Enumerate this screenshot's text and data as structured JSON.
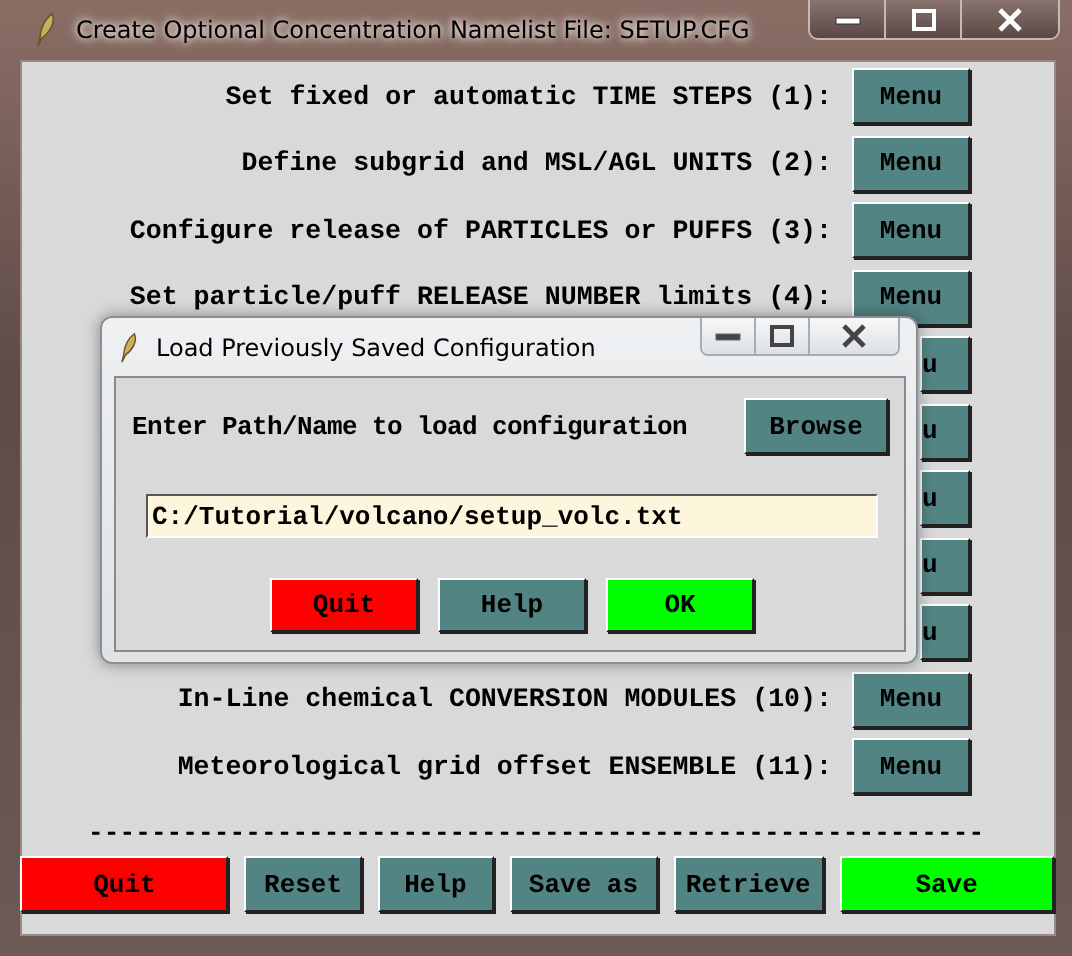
{
  "window": {
    "title": "Create Optional Concentration Namelist File: SETUP.CFG"
  },
  "rows": [
    {
      "kind": "labeled",
      "label": "Set fixed or automatic TIME STEPS (1):",
      "button": "Menu"
    },
    {
      "kind": "labeled",
      "label": "Define subgrid and MSL/AGL UNITS (2):",
      "button": "Menu"
    },
    {
      "kind": "labeled",
      "label": "Configure release of PARTICLES or PUFFS (3):",
      "button": "Menu"
    },
    {
      "kind": "labeled",
      "label": "Set particle/puff RELEASE NUMBER limits (4):",
      "button": "Menu"
    },
    {
      "kind": "covered",
      "button": "u"
    },
    {
      "kind": "covered",
      "button": "u"
    },
    {
      "kind": "covered",
      "button": "u"
    },
    {
      "kind": "covered",
      "button": "u"
    },
    {
      "kind": "covered",
      "button": "u"
    },
    {
      "kind": "labeled",
      "label": "In-Line chemical CONVERSION MODULES (10):",
      "button": "Menu"
    },
    {
      "kind": "labeled",
      "label": "Meteorological grid offset ENSEMBLE (11):",
      "button": "Menu"
    }
  ],
  "separator": "---------------------------------------------------------",
  "buttons": [
    {
      "label": "Quit",
      "color": "#ff0000"
    },
    {
      "label": "Reset",
      "color": "#538484"
    },
    {
      "label": "Help",
      "color": "#538484"
    },
    {
      "label": "Save as",
      "color": "#538484"
    },
    {
      "label": "Retrieve",
      "color": "#538484"
    },
    {
      "label": "Save",
      "color": "#00ff00"
    }
  ],
  "dialog": {
    "title": "Load Previously Saved Configuration",
    "prompt": "Enter Path/Name to load configuration",
    "browse_button": "Browse",
    "path_value": "C:/Tutorial/volcano/setup_volc.txt",
    "buttons": [
      {
        "label": "Quit",
        "color": "#ff0000"
      },
      {
        "label": "Help",
        "color": "#538484"
      },
      {
        "label": "OK",
        "color": "#00ff00"
      }
    ]
  }
}
